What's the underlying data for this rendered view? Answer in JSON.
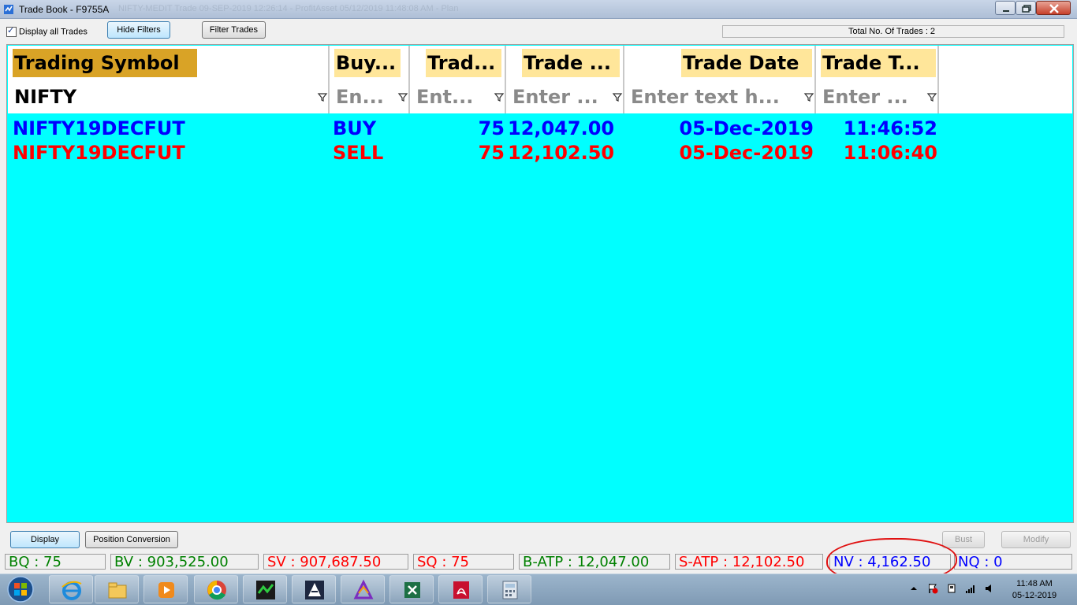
{
  "window": {
    "title": "Trade Book - F9755A",
    "title_suffix_blurred": "NIFTY-MEDIT Trade 09-SEP-2019 12:26:14 - ProfitAsset 05/12/2019 11:48:08 AM - Plan"
  },
  "toolbar": {
    "display_all_label": "Display all Trades",
    "display_all_checked": true,
    "hide_filters_label": "Hide Filters",
    "filter_trades_label": "Filter Trades",
    "total_trades_text": "Total No. Of Trades : 2"
  },
  "grid": {
    "columns": [
      {
        "header": "Trading Symbol",
        "filter": "NIFTY"
      },
      {
        "header": "Buy...",
        "filter": "En..."
      },
      {
        "header": "Trad...",
        "filter": "Ent..."
      },
      {
        "header": "Trade ...",
        "filter": "Enter ..."
      },
      {
        "header": "Trade Date",
        "filter": "Enter text h..."
      },
      {
        "header": "Trade T...",
        "filter": "Enter ..."
      }
    ],
    "rows": [
      {
        "symbol": "NIFTY19DECFUT",
        "side": "BUY",
        "qty": "75",
        "price": "12,047.00",
        "date": "05-Dec-2019",
        "time": "11:46:52",
        "color": "#0000ff"
      },
      {
        "symbol": "NIFTY19DECFUT",
        "side": "SELL",
        "qty": "75",
        "price": "12,102.50",
        "date": "05-Dec-2019",
        "time": "11:06:40",
        "color": "#ff0000"
      }
    ],
    "background": "#00ffff"
  },
  "actions": {
    "display_label": "Display",
    "position_conversion_label": "Position Conversion",
    "bust_label": "Bust",
    "modify_label": "Modify"
  },
  "stats": {
    "bq": "BQ : 75",
    "bv": "BV : 903,525.00",
    "sv": "SV : 907,687.50",
    "sq": "SQ : 75",
    "batp": "B-ATP : 12,047.00",
    "satp": "S-ATP : 12,102.50",
    "nv": "NV : 4,162.50",
    "nq": "NQ : 0"
  },
  "taskbar": {
    "time": "11:48 AM",
    "date": "05-12-2019",
    "apps": [
      "internet-explorer-icon",
      "file-explorer-icon",
      "media-player-icon",
      "chrome-icon",
      "trading-app-icon",
      "terminal-app-icon",
      "chart-app-icon",
      "excel-icon",
      "pdf-reader-icon",
      "calculator-icon"
    ]
  }
}
